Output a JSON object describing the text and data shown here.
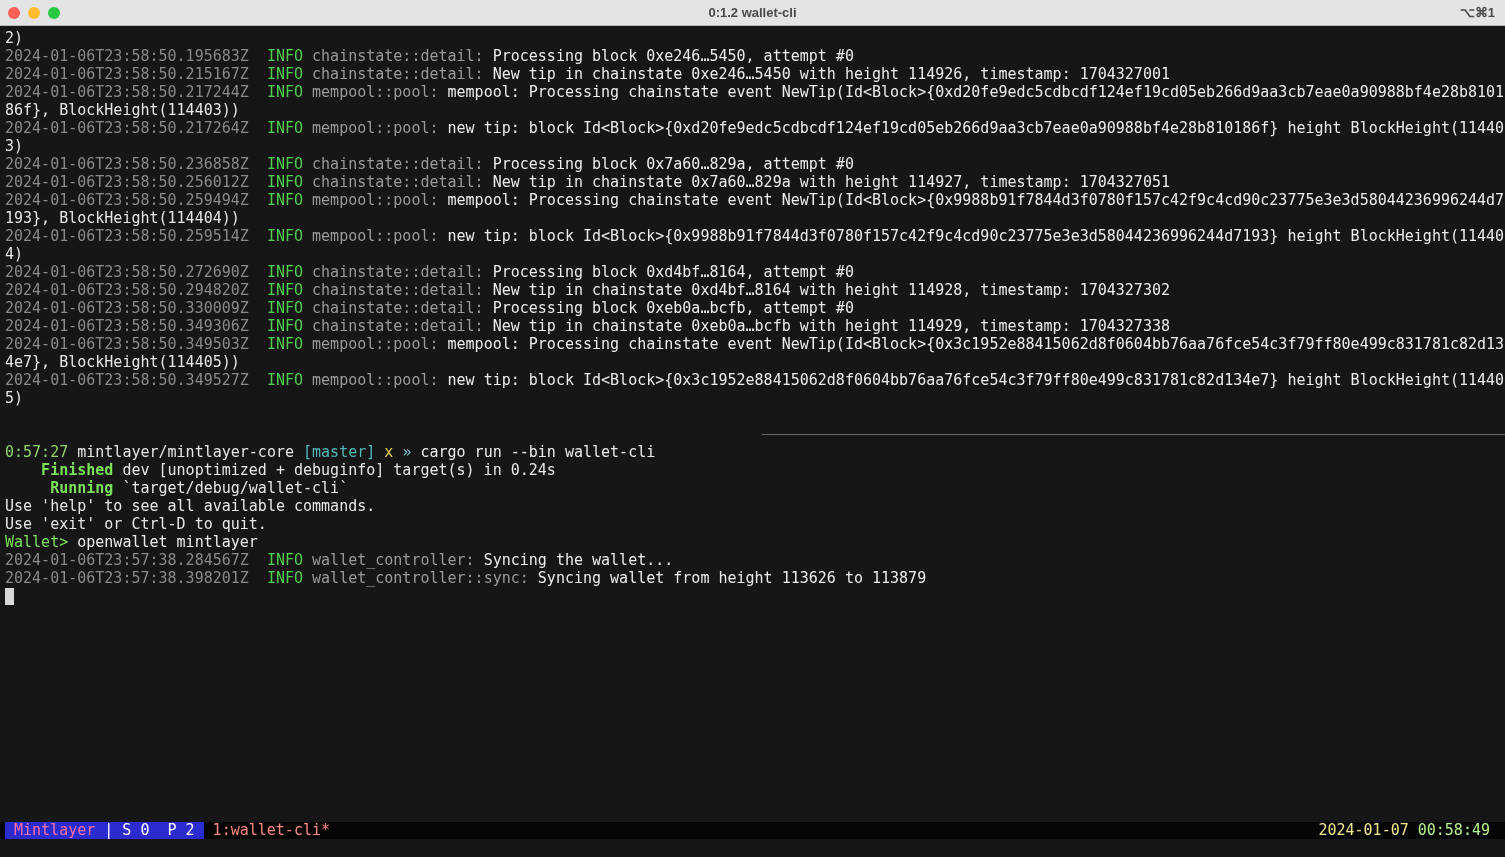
{
  "window": {
    "title": "0:1.2 wallet-cli",
    "shortcut": "⌥⌘1"
  },
  "terminal": {
    "cursor_visible": true,
    "lines": [
      {
        "kind": "text",
        "text": "2)"
      },
      {
        "kind": "log",
        "timestamp": "2024-01-06T23:58:50.195683Z",
        "level": "INFO",
        "target": "chainstate::detail:",
        "message": "Processing block 0xe246…5450, attempt #0"
      },
      {
        "kind": "log",
        "timestamp": "2024-01-06T23:58:50.215167Z",
        "level": "INFO",
        "target": "chainstate::detail:",
        "message": "New tip in chainstate 0xe246…5450 with height 114926, timestamp: 1704327001"
      },
      {
        "kind": "log",
        "timestamp": "2024-01-06T23:58:50.217244Z",
        "level": "INFO",
        "target": "mempool::pool:",
        "message": "mempool: Processing chainstate event NewTip(Id<Block>{0xd20fe9edc5cdbcdf124ef19cd05eb266d9aa3cb7eae0a90988bf4e28b8101"
      },
      {
        "kind": "text",
        "text": "86f}, BlockHeight(114403))"
      },
      {
        "kind": "log",
        "timestamp": "2024-01-06T23:58:50.217264Z",
        "level": "INFO",
        "target": "mempool::pool:",
        "message": "new tip: block Id<Block>{0xd20fe9edc5cdbcdf124ef19cd05eb266d9aa3cb7eae0a90988bf4e28b810186f} height BlockHeight(11440"
      },
      {
        "kind": "text",
        "text": "3)"
      },
      {
        "kind": "log",
        "timestamp": "2024-01-06T23:58:50.236858Z",
        "level": "INFO",
        "target": "chainstate::detail:",
        "message": "Processing block 0x7a60…829a, attempt #0"
      },
      {
        "kind": "log",
        "timestamp": "2024-01-06T23:58:50.256012Z",
        "level": "INFO",
        "target": "chainstate::detail:",
        "message": "New tip in chainstate 0x7a60…829a with height 114927, timestamp: 1704327051"
      },
      {
        "kind": "log",
        "timestamp": "2024-01-06T23:58:50.259494Z",
        "level": "INFO",
        "target": "mempool::pool:",
        "message": "mempool: Processing chainstate event NewTip(Id<Block>{0x9988b91f7844d3f0780f157c42f9c4cd90c23775e3e3d58044236996244d7"
      },
      {
        "kind": "text",
        "text": "193}, BlockHeight(114404))"
      },
      {
        "kind": "log",
        "timestamp": "2024-01-06T23:58:50.259514Z",
        "level": "INFO",
        "target": "mempool::pool:",
        "message": "new tip: block Id<Block>{0x9988b91f7844d3f0780f157c42f9c4cd90c23775e3e3d58044236996244d7193} height BlockHeight(11440"
      },
      {
        "kind": "text",
        "text": "4)"
      },
      {
        "kind": "log",
        "timestamp": "2024-01-06T23:58:50.272690Z",
        "level": "INFO",
        "target": "chainstate::detail:",
        "message": "Processing block 0xd4bf…8164, attempt #0"
      },
      {
        "kind": "log",
        "timestamp": "2024-01-06T23:58:50.294820Z",
        "level": "INFO",
        "target": "chainstate::detail:",
        "message": "New tip in chainstate 0xd4bf…8164 with height 114928, timestamp: 1704327302"
      },
      {
        "kind": "log",
        "timestamp": "2024-01-06T23:58:50.330009Z",
        "level": "INFO",
        "target": "chainstate::detail:",
        "message": "Processing block 0xeb0a…bcfb, attempt #0"
      },
      {
        "kind": "log",
        "timestamp": "2024-01-06T23:58:50.349306Z",
        "level": "INFO",
        "target": "chainstate::detail:",
        "message": "New tip in chainstate 0xeb0a…bcfb with height 114929, timestamp: 1704327338"
      },
      {
        "kind": "log",
        "timestamp": "2024-01-06T23:58:50.349503Z",
        "level": "INFO",
        "target": "mempool::pool:",
        "message": "mempool: Processing chainstate event NewTip(Id<Block>{0x3c1952e88415062d8f0604bb76aa76fce54c3f79ff80e499c831781c82d13"
      },
      {
        "kind": "text",
        "text": "4e7}, BlockHeight(114405))"
      },
      {
        "kind": "log",
        "timestamp": "2024-01-06T23:58:50.349527Z",
        "level": "INFO",
        "target": "mempool::pool:",
        "message": "new tip: block Id<Block>{0x3c1952e88415062d8f0604bb76aa76fce54c3f79ff80e499c831781c82d134e7} height BlockHeight(11440"
      },
      {
        "kind": "text",
        "text": "5)"
      },
      {
        "kind": "blank",
        "rule": false
      },
      {
        "kind": "blank",
        "rule": true
      },
      {
        "kind": "prompt",
        "time": "0:57:27",
        "path": "mintlayer/mintlayer-core",
        "branch": "[master]",
        "dirty": "x",
        "arrow": "»",
        "command": "cargo run --bin wallet-cli"
      },
      {
        "kind": "cargo",
        "status": "Finished",
        "text": "dev [unoptimized + debuginfo] target(s) in 0.24s"
      },
      {
        "kind": "cargo",
        "status": "Running",
        "text": "`target/debug/wallet-cli`"
      },
      {
        "kind": "text",
        "text": "Use 'help' to see all available commands."
      },
      {
        "kind": "text",
        "text": "Use 'exit' or Ctrl-D to quit."
      },
      {
        "kind": "repl",
        "prompt": "Wallet>",
        "command": "openwallet mintlayer"
      },
      {
        "kind": "log",
        "timestamp": "2024-01-06T23:57:38.284567Z",
        "level": "INFO",
        "target": "wallet_controller:",
        "message": "Syncing the wallet..."
      },
      {
        "kind": "log",
        "timestamp": "2024-01-06T23:57:38.398201Z",
        "level": "INFO",
        "target": "wallet_controller::sync:",
        "message": "Syncing wallet from height 113626 to 113879"
      }
    ]
  },
  "status_bar": {
    "session": "Mintlayer",
    "panes": "| S 0  P 2",
    "window_tab": "1:wallet-cli*",
    "date": "2024-01-07",
    "time": "00:58:49"
  }
}
